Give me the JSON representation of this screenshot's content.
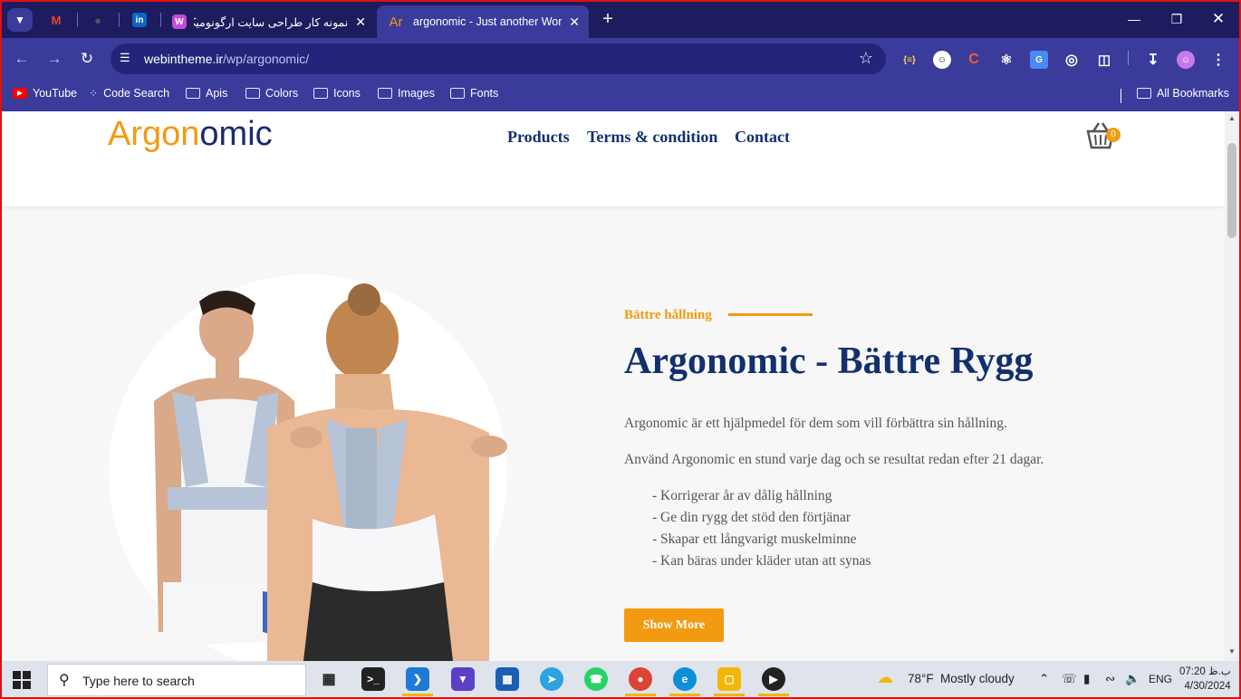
{
  "browser": {
    "tabs": [
      {
        "label": "",
        "favicon": "gmail-icon"
      },
      {
        "label": "",
        "favicon": "github-icon"
      },
      {
        "label": "",
        "favicon": "linkedin-icon"
      },
      {
        "label": "نمونه کار طراحی سایت ارگونومیک",
        "favicon": "site-icon"
      },
      {
        "label": "argonomic - Just another WordPress site",
        "favicon": "Ar"
      }
    ],
    "url_domain": "webintheme.ir",
    "url_path": "/wp/argonomic/",
    "bookmarks": [
      "YouTube",
      "Code Search",
      "Apis",
      "Colors",
      "Icons",
      "Images",
      "Fonts"
    ],
    "all_bookmarks": "All Bookmarks"
  },
  "site": {
    "logo_part1": "Argon",
    "logo_part2": "omic",
    "nav": [
      "Products",
      "Terms & condition",
      "Contact"
    ],
    "cart_count": "0"
  },
  "hero": {
    "eyebrow": "Bättre hållning",
    "title": "Argonomic - Bättre Rygg",
    "paragraphs": [
      "Argonomic är ett hjälpmedel för dem som vill förbättra sin hållning.",
      "Använd Argonomic en stund varje dag och se resultat redan efter 21 dagar."
    ],
    "list": [
      "- Korrigerar år av dålig hållning",
      "- Ge din rygg det stöd den förtjänar",
      "- Skapar ett långvarigt muskelminne",
      "- Kan bäras under kläder utan att synas"
    ],
    "button": "Show More"
  },
  "taskbar": {
    "search_placeholder": "Type here to search",
    "weather_temp": "78°F",
    "weather_text": "Mostly cloudy",
    "lang": "ENG",
    "time": "07:20 ب.ظ",
    "date": "4/30/2024"
  },
  "colors": {
    "accent": "#f29a12",
    "navy": "#13306e",
    "browser": "#3a3b9a"
  }
}
